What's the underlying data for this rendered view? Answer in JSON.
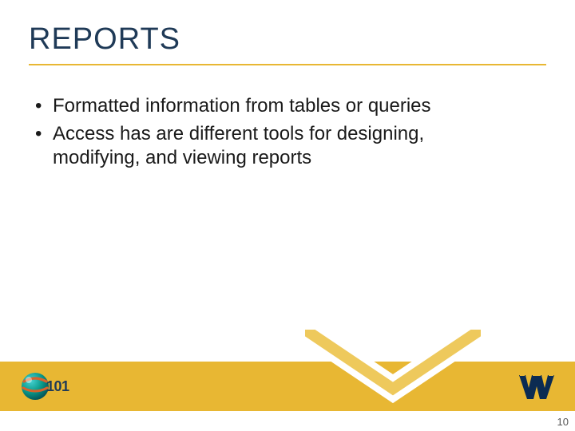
{
  "title": "REPORTS",
  "bullets": [
    "Formatted information from tables or queries",
    "Access has are different tools for designing, modifying, and viewing reports"
  ],
  "logo101": "101",
  "page_number": "10",
  "colors": {
    "accent": "#e8b733",
    "title": "#1f3a57",
    "wv_blue": "#0b2b52"
  }
}
